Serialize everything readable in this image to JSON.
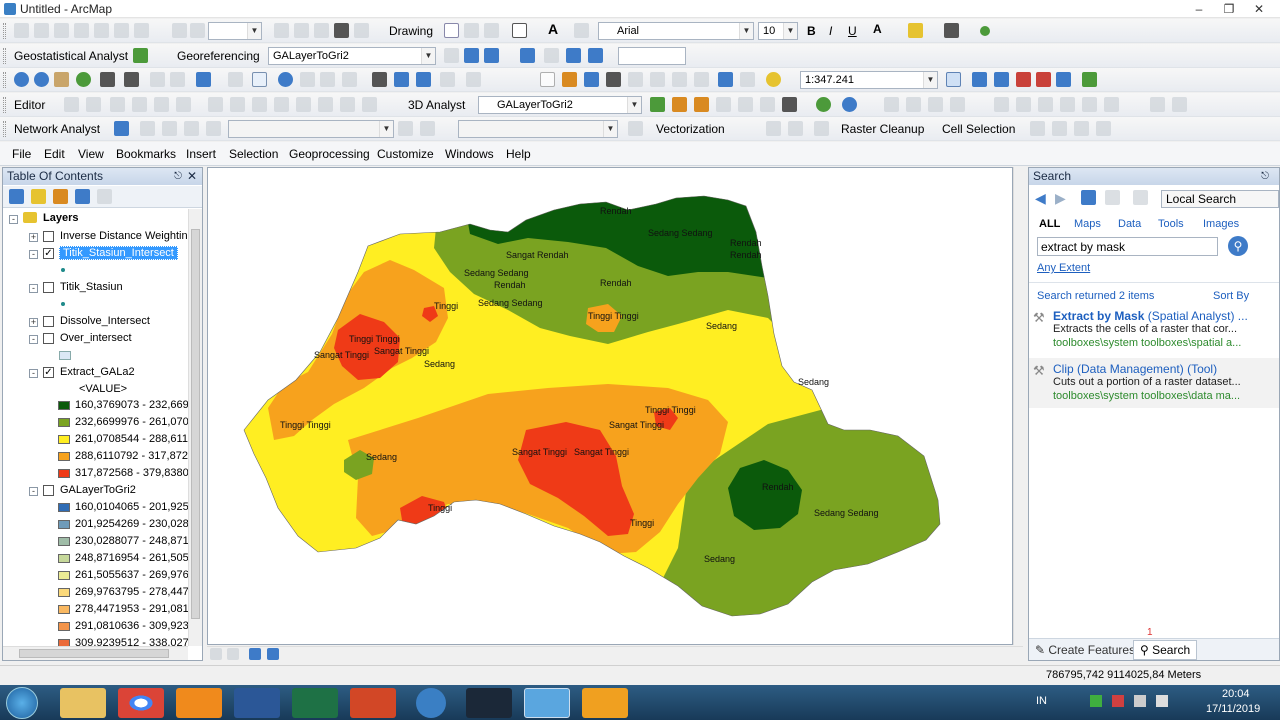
{
  "window": {
    "title": "Untitled - ArcMap"
  },
  "toolbar": {
    "drawing_label": "Drawing",
    "font_name": "Arial",
    "font_size": "10",
    "geostat_label": "Geostatistical Analyst",
    "georef_label": "Georeferencing",
    "georef_layer": "GALayerToGri2",
    "scale": "1:347.241",
    "editor_label": "Editor",
    "analyst3d_label": "3D Analyst",
    "analyst3d_layer": "GALayerToGri2",
    "network_label": "Network Analyst",
    "vectorization_label": "Vectorization",
    "raster_cleanup_label": "Raster Cleanup",
    "cell_selection_label": "Cell Selection"
  },
  "menu": [
    "File",
    "Edit",
    "View",
    "Bookmarks",
    "Insert",
    "Selection",
    "Geoprocessing",
    "Customize",
    "Windows",
    "Help"
  ],
  "toc": {
    "title": "Table Of Contents",
    "root": "Layers",
    "layers": {
      "idw": "Inverse Distance Weighting",
      "titik_intersect": "Titik_Stasiun_Intersect",
      "titik": "Titik_Stasiun",
      "dissolve": "Dissolve_Intersect",
      "over": "Over_intersect",
      "extract": "Extract_GALa2",
      "value_header": "<VALUE>",
      "galayer": "GALayerToGri2"
    },
    "extract_legend": [
      {
        "label": "160,3769073 - 232,6699",
        "color": "#0b5a0b"
      },
      {
        "label": "232,6699976 - 261,0708",
        "color": "#7aa321"
      },
      {
        "label": "261,0708544 - 288,6110",
        "color": "#ffee22"
      },
      {
        "label": "288,6110792 - 317,8725",
        "color": "#f7a21d"
      },
      {
        "label": "317,872568 - 379,83807",
        "color": "#ef3a17"
      }
    ],
    "galayer_legend": [
      {
        "label": "160,0104065 - 201,9254",
        "color": "#2f6cb5"
      },
      {
        "label": "201,9254269 - 230,0288",
        "color": "#6f9bb9"
      },
      {
        "label": "230,0288077 - 248,8716",
        "color": "#9fbca7"
      },
      {
        "label": "248,8716954 - 261,5055",
        "color": "#c6d89a"
      },
      {
        "label": "261,5055637 - 269,9763",
        "color": "#ecec95"
      },
      {
        "label": "269,9763795 - 278,4471",
        "color": "#fbd97a"
      },
      {
        "label": "278,4471953 - 291,0810",
        "color": "#f9b861"
      },
      {
        "label": "291,0810636 - 309,9239",
        "color": "#f3944a"
      },
      {
        "label": "309,9239512 - 338,0273",
        "color": "#eb6a39"
      }
    ]
  },
  "map_labels": [
    {
      "t": "Rendah"
    },
    {
      "t": "Sedang Sedang"
    },
    {
      "t": "Rendah"
    },
    {
      "t": "Rendah"
    },
    {
      "t": "Sangat Rendah"
    },
    {
      "t": "Sedang Sedang"
    },
    {
      "t": "Rendah"
    },
    {
      "t": "Sedang Sedang"
    },
    {
      "t": "Rendah"
    },
    {
      "t": "Tinggi"
    },
    {
      "t": "Tinggi Tinggi"
    },
    {
      "t": "Sedang"
    },
    {
      "t": "Tinggi Tinggi"
    },
    {
      "t": "Sangat Tinggi"
    },
    {
      "t": "Sangat Tinggi"
    },
    {
      "t": "Sedang"
    },
    {
      "t": "Sedang"
    },
    {
      "t": "Tinggi Tinggi"
    },
    {
      "t": "Sedang"
    },
    {
      "t": "Tinggi Tinggi"
    },
    {
      "t": "Sangat Tinggi"
    },
    {
      "t": "Sangat Tinggi"
    },
    {
      "t": "Sangat Tinggi"
    },
    {
      "t": "Rendah"
    },
    {
      "t": "Tinggi"
    },
    {
      "t": "Tinggi"
    },
    {
      "t": "Sedang Sedang"
    },
    {
      "t": "Sedang"
    }
  ],
  "search": {
    "title": "Search",
    "scope": "Local Search",
    "tabs": [
      "ALL",
      "Maps",
      "Data",
      "Tools",
      "Images"
    ],
    "query": "extract by mask",
    "any_extent": "Any Extent",
    "returned": "Search returned 2 items",
    "sort_by": "Sort By",
    "results": [
      {
        "title": "Extract by Mask",
        "type": "(Spatial Analyst) ...",
        "desc": "Extracts the cells of a raster that cor...",
        "path": "toolboxes\\system toolboxes\\spatial a..."
      },
      {
        "title": "Clip",
        "type": "(Data Management) (Tool)",
        "desc": "Cuts out a portion of a raster dataset...",
        "path": "toolboxes\\system toolboxes\\data ma..."
      }
    ],
    "bottom_tabs": {
      "create_features": "Create Features",
      "search": "Search",
      "badge": "1"
    }
  },
  "status": {
    "coords": "786795,742  9114025,84 Meters"
  },
  "taskbar": {
    "lang": "IN",
    "time": "20:04",
    "date": "17/11/2019"
  }
}
